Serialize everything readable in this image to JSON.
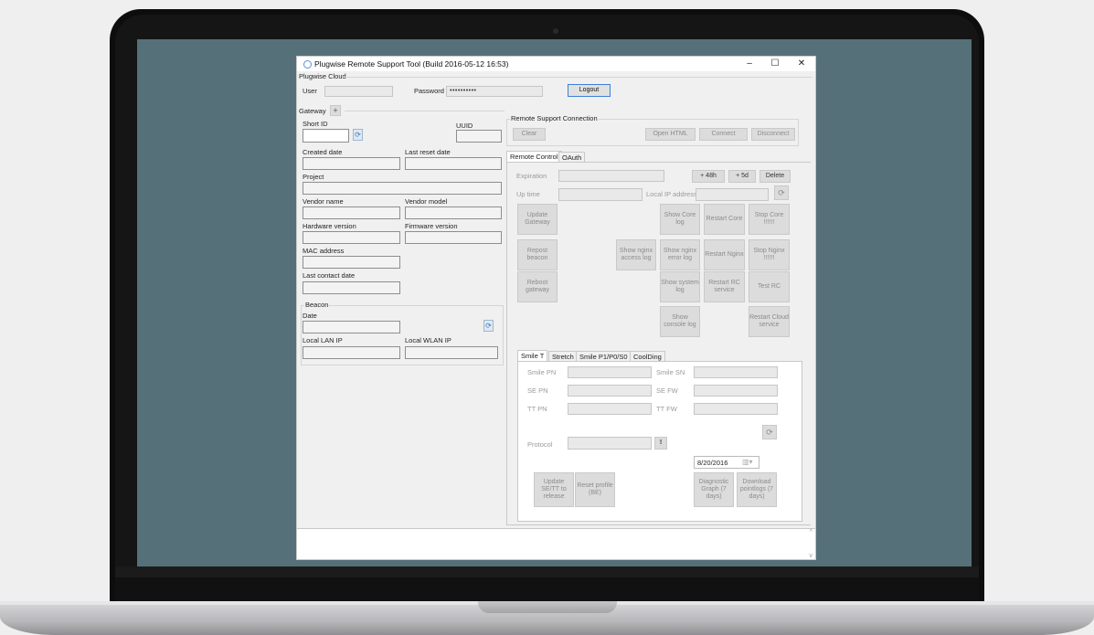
{
  "window": {
    "title": "Plugwise Remote Support Tool (Build 2016-05-12 16:53)",
    "minimize": "–",
    "maximize": "☐",
    "close": "✕"
  },
  "cloud": {
    "group_label": "Plugwise Cloud",
    "user_label": "User",
    "password_label": "Password",
    "password_value": "••••••••••",
    "logout_label": "Logout"
  },
  "gateway": {
    "group_label": "Gateway",
    "add_label": "+",
    "short_id_label": "Short ID",
    "uuid_label": "UUID",
    "created_label": "Created date",
    "last_reset_label": "Last reset date",
    "project_label": "Project",
    "vendor_name_label": "Vendor name",
    "vendor_model_label": "Vendor model",
    "hw_label": "Hardware version",
    "fw_label": "Firmware version",
    "mac_label": "MAC address",
    "last_contact_label": "Last contact date",
    "beacon": {
      "group_label": "Beacon",
      "date_label": "Date",
      "lan_label": "Local LAN IP",
      "wlan_label": "Local WLAN IP"
    }
  },
  "remote": {
    "group_label": "Remote Support Connection",
    "clear": "Clear",
    "open_html": "Open HTML",
    "connect": "Connect",
    "disconnect": "Disconnect"
  },
  "tabs_top": [
    "Remote Control",
    "OAuth"
  ],
  "remote_control": {
    "expiration_label": "Expiration",
    "plus48h": "+ 48h",
    "plus5d": "+ 5d",
    "delete": "Delete",
    "uptime_label": "Up time",
    "local_ip_label": "Local IP address",
    "buttons": {
      "update_gateway": "Update Gateway",
      "show_core_log": "Show Core log",
      "restart_core": "Restart Core",
      "stop_core": "Stop Core !!!!!!",
      "repost_beacon": "Repost beacon",
      "show_nginx_access": "Show nginx access log",
      "show_nginx_error": "Show nginx error log",
      "restart_nginx": "Restart Nginx",
      "stop_nginx": "Stop Nginx !!!!!!",
      "reboot_gateway": "Reboot gateway",
      "show_system_log": "Show system log",
      "restart_rc": "Restart RC service",
      "test_rc": "Test RC",
      "show_console_log": "Show console log",
      "restart_cloud": "Restart Cloud service"
    }
  },
  "tabs_bottom": [
    "Smile T",
    "Stretch",
    "Smile P1/P0/S0",
    "CoolDing"
  ],
  "smile": {
    "smile_pn": "Smile PN",
    "smile_sn": "Smile SN",
    "se_pn": "SE PN",
    "se_fw": "SE FW",
    "tt_pn": "TT PN",
    "tt_fw": "TT FW",
    "protocol": "Protocol",
    "warn": "!",
    "date_value": "8/20/2016",
    "update_se": "Update SE/TT to release",
    "reset_profile": "Reset profile (BE)",
    "diag_graph": "Diagnostic Graph (7 days)",
    "download_logs": "Download pointlogs (7 days)"
  },
  "log": {
    "scroll_up": "^",
    "scroll_down": "v"
  }
}
